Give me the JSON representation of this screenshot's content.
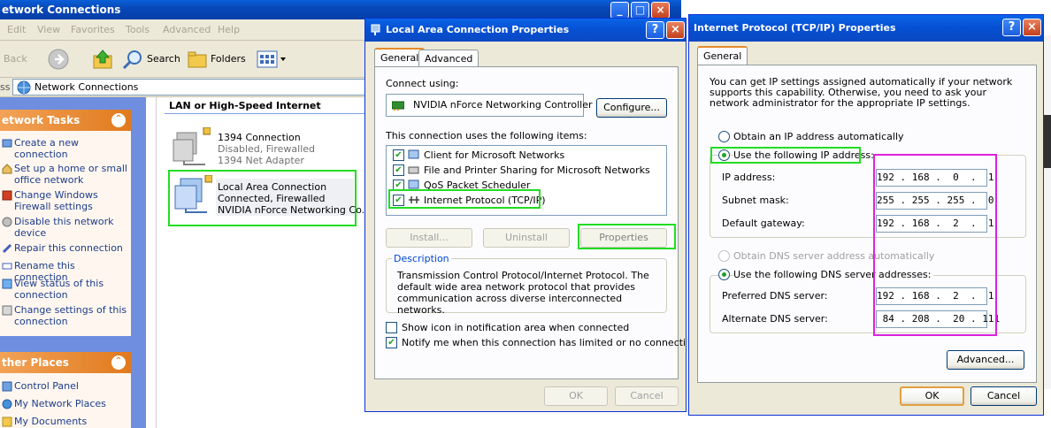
{
  "explorer": {
    "title": "etwork Connections",
    "menu": [
      "Edit",
      "View",
      "Favorites",
      "Tools",
      "Advanced",
      "Help"
    ],
    "toolbar": {
      "back": "Back",
      "search": "Search",
      "folders": "Folders"
    },
    "address_label": "ss",
    "address_value": "Network Connections",
    "network_tasks_title": "etwork Tasks",
    "network_tasks": [
      "Create a new connection",
      "Set up a home or small office network",
      "Change Windows Firewall settings",
      "Disable this network device",
      "Repair this connection",
      "Rename this connection",
      "View status of this connection",
      "Change settings of this connection"
    ],
    "other_places_title": "ther Places",
    "other_places": [
      "Control Panel",
      "My Network Places",
      "My Documents"
    ],
    "group_heading": "LAN or High-Speed Internet",
    "connections": [
      {
        "name": "1394 Connection",
        "status": "Disabled, Firewalled",
        "device": "1394 Net Adapter"
      },
      {
        "name": "Local Area Connection",
        "status": "Connected, Firewalled",
        "device": "NVIDIA nForce Networking Co..."
      }
    ]
  },
  "lan_dialog": {
    "title": "Local Area Connection Properties",
    "tabs": [
      "General",
      "Advanced"
    ],
    "connect_using_label": "Connect using:",
    "adapter": "NVIDIA nForce Networking Controller",
    "configure_label": "Configure...",
    "items_label": "This connection uses the following items:",
    "items": [
      {
        "label": "Client for Microsoft Networks",
        "checked": true
      },
      {
        "label": "File and Printer Sharing for Microsoft Networks",
        "checked": true
      },
      {
        "label": "QoS Packet Scheduler",
        "checked": true
      },
      {
        "label": "Internet Protocol (TCP/IP)",
        "checked": true
      }
    ],
    "install_label": "Install...",
    "uninstall_label": "Uninstall",
    "properties_label": "Properties",
    "description_title": "Description",
    "description_text": "Transmission Control Protocol/Internet Protocol. The default wide area network protocol that provides communication across diverse interconnected networks.",
    "show_icon_label": "Show icon in notification area when connected",
    "notify_label": "Notify me when this connection has limited or no connectivity",
    "notify_checked": true,
    "ok_label": "OK",
    "cancel_label": "Cancel"
  },
  "tcpip_dialog": {
    "title": "Internet Protocol (TCP/IP) Properties",
    "tab": "General",
    "intro": "You can get IP settings assigned automatically if your network supports this capability. Otherwise, you need to ask your network administrator for the appropriate IP settings.",
    "auto_ip_label": "Obtain an IP address automatically",
    "manual_ip_label": "Use the following IP address:",
    "ip_label": "IP address:",
    "ip_value": "192 . 168 .  0  .  1",
    "subnet_label": "Subnet mask:",
    "subnet_value": "255 . 255 . 255 .  0",
    "gateway_label": "Default gateway:",
    "gateway_value": "192 . 168 .  2  .  1",
    "auto_dns_label": "Obtain DNS server address automatically",
    "manual_dns_label": "Use the following DNS server addresses:",
    "preferred_dns_label": "Preferred DNS server:",
    "preferred_dns_value": "192 . 168 .  2  .  1",
    "alternate_dns_label": "Alternate DNS server:",
    "alternate_dns_value": " 84 . 208 .  20 . 111",
    "advanced_label": "Advanced...",
    "ok_label": "OK",
    "cancel_label": "Cancel"
  },
  "colors": {
    "title_blue": "#0651d4",
    "highlight_green": "#22dd22",
    "highlight_magenta": "#dd22dd",
    "sidebar_blue": "#6f8ee0"
  }
}
